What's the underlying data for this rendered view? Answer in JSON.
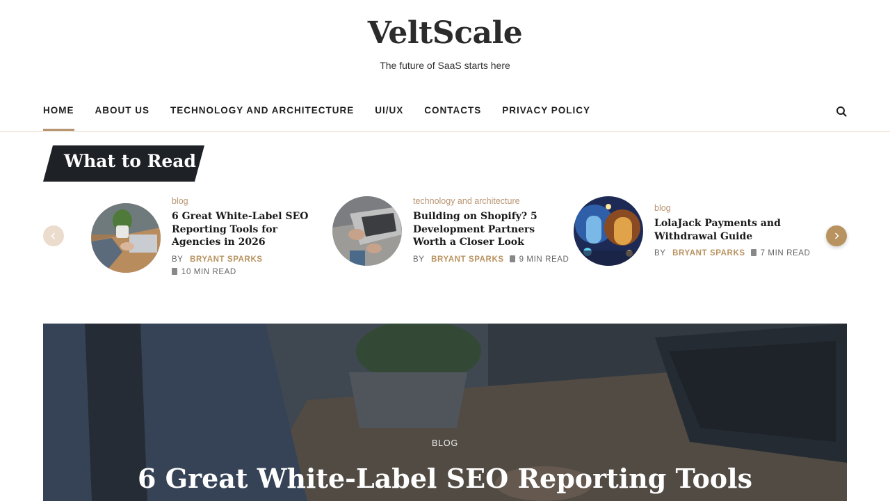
{
  "site": {
    "title": "VeltScale",
    "tagline": "The future of SaaS starts here"
  },
  "nav": {
    "items": [
      {
        "label": "HOME",
        "active": true
      },
      {
        "label": "ABOUT US"
      },
      {
        "label": "TECHNOLOGY AND ARCHITECTURE"
      },
      {
        "label": "UI/UX"
      },
      {
        "label": "CONTACTS"
      },
      {
        "label": "PRIVACY POLICY"
      }
    ],
    "search_icon": "search-icon"
  },
  "what_to_read": {
    "heading": "What to Read",
    "prev_icon": "chevron-left-icon",
    "next_icon": "chevron-right-icon",
    "cards": [
      {
        "category": "blog",
        "title": "6 Great White-Label SEO Reporting Tools for Agencies in 2026",
        "by": "BY",
        "author": "BRYANT SPARKS",
        "read_time": "10 MIN READ"
      },
      {
        "category": "technology and architecture",
        "title": "Building on Shopify? 5 Development Partners Worth a Closer Look",
        "by": "BY",
        "author": "BRYANT SPARKS",
        "read_time": "9 MIN READ"
      },
      {
        "category": "blog",
        "title": "LolaJack Payments and Withdrawal Guide",
        "by": "BY",
        "author": "BRYANT SPARKS",
        "read_time": "7 MIN READ"
      }
    ]
  },
  "hero": {
    "category": "BLOG",
    "title": "6 Great White-Label SEO Reporting Tools"
  },
  "colors": {
    "accent": "#b8925f",
    "accent_light": "#ecdccd",
    "dark_label": "#1e2126"
  }
}
